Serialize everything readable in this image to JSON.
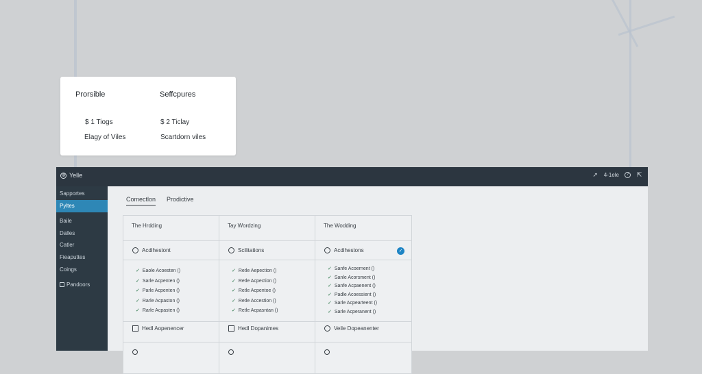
{
  "card": {
    "columns": [
      {
        "heading": "Prorsible",
        "line1": "$ 1 Tiogs",
        "line2": "Elagy of Viles"
      },
      {
        "heading": "Seffcpures",
        "line1": "$ 2 Ticlay",
        "line2": "Scartdorn viles"
      }
    ]
  },
  "topbar": {
    "brand": "Yelle",
    "right_text": "4-1ele"
  },
  "sidebar": {
    "items": [
      {
        "label": "Sapportes"
      },
      {
        "label": "Pyltes",
        "active": true
      },
      {
        "label": "Baile"
      },
      {
        "label": "Dalles"
      },
      {
        "label": "Catler"
      },
      {
        "label": "Fieaputtes"
      },
      {
        "label": "Coings"
      },
      {
        "label": "Pandoors"
      }
    ]
  },
  "tabs": [
    {
      "label": "Comectlon",
      "active": true
    },
    {
      "label": "Prodictive"
    }
  ],
  "plans": [
    {
      "header": "The Hrdding",
      "subtitle": "Acdihestont",
      "features": [
        "Eaole Acoesten ()",
        "Sarle Acpenten ()",
        "Parle Acpenten ()",
        "Rarle Acpaston ()",
        "Rarle Acpasten ()"
      ],
      "footer": "Hedl Aopenencer",
      "selected": false
    },
    {
      "header": "Tay Wordzing",
      "subtitle": "Scilitations",
      "features": [
        "Retle Aepection ()",
        "Retle Acpection ()",
        "Retle Acpentoe ()",
        "Retle Accestion ()",
        "Retle Acpasntan ()"
      ],
      "footer": "Hedl Dopanimes",
      "selected": false
    },
    {
      "header": "The Wodding",
      "subtitle": "Acdihestons",
      "features": [
        "Sanfe Acoernent ()",
        "Sanle Acorsment ()",
        "Sanfe Acpaenent ()",
        "Padle Acoessient ()",
        "Sarle Acpearteent ()",
        "Sarle Acperanent ()"
      ],
      "footer": "Veile Dopeanenter",
      "selected": true
    }
  ],
  "colors": {
    "sidebar": "#2d3a44",
    "topbar": "#2c3640",
    "accent": "#2e87b6",
    "check": "#1f6e3f"
  }
}
